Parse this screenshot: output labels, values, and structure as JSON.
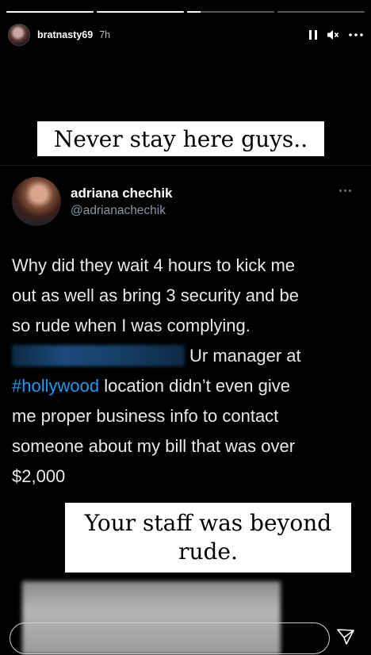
{
  "story": {
    "progress": [
      1,
      1,
      0.15,
      0,
      0
    ],
    "username": "bratnasty69",
    "time": "7h",
    "icons": [
      "pause-icon",
      "mute-icon",
      "more-options-icon"
    ]
  },
  "caption_top": "Never stay here guys..",
  "tweet": {
    "name": "adriana chechik",
    "handle": "@adrianachechik",
    "line1": "Why did they wait 4 hours to kick me",
    "line2": "out as well as bring 3 security and be",
    "line3": "so rude when I was complying.",
    "line4_rest": "Ur manager at",
    "hashtag": "#hollywood",
    "line5_rest": " location didn’t even give",
    "line6": "me proper business info to contact",
    "line7": "someone about my bill that was over",
    "line8": "$2,000"
  },
  "caption_bottom": {
    "line1": "Your staff was beyond",
    "line2": "rude."
  },
  "reply": {
    "placeholder": ""
  },
  "colors": {
    "background": "#000000",
    "hashtag": "#1d9bf0",
    "handle": "#8b98a5"
  }
}
